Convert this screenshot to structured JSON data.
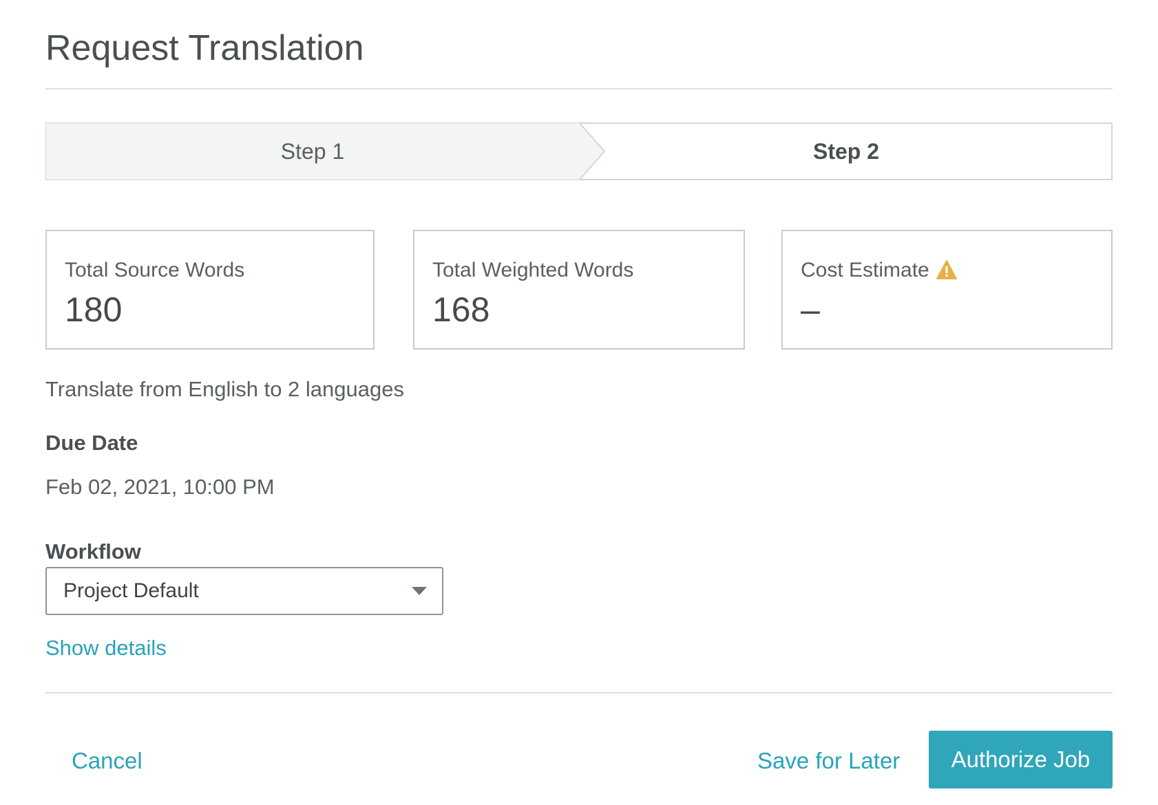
{
  "dialog": {
    "title": "Request Translation"
  },
  "stepper": {
    "steps": [
      {
        "label": "Step 1",
        "state": "completed"
      },
      {
        "label": "Step 2",
        "state": "active"
      }
    ]
  },
  "stats": [
    {
      "label": "Total Source Words",
      "value": "180"
    },
    {
      "label": "Total Weighted Words",
      "value": "168"
    },
    {
      "label": "Cost Estimate",
      "value": "–",
      "icon": "warning-icon"
    }
  ],
  "summary": "Translate from English to 2 languages",
  "due_date": {
    "label": "Due Date",
    "value": "Feb 02, 2021, 10:00 PM"
  },
  "workflow": {
    "label": "Workflow",
    "selected": "Project Default",
    "details_link": "Show details"
  },
  "footer": {
    "cancel_label": "Cancel",
    "save_label": "Save for Later",
    "authorize_label": "Authorize Job"
  },
  "colors": {
    "accent": "#2fa6b9",
    "warning": "#e8b04a",
    "completed_step_bg": "#f3f4f4"
  }
}
